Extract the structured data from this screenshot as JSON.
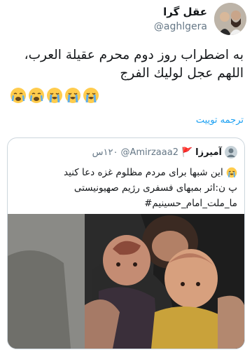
{
  "tweet": {
    "display_name": "عقل گرا",
    "handle": "@aghlgera",
    "text_line1": "به اضطراب روز دوم محرم عقيلة العرب،",
    "text_line2": "اللهم عجل لوليك الفرج",
    "emojis": [
      "crying-face",
      "crying-face",
      "loudly-crying-face",
      "loudly-crying-face",
      "loudly-crying-face"
    ],
    "translate_label": "ترجمه توییت"
  },
  "quoted": {
    "display_name": "آمیرزا",
    "flag": "🚩",
    "handle": "@Amirzaaa2",
    "time": "۱۲۰س",
    "line1": "این شبها برای مردم مظلوم غزه دعا کنید",
    "line2": "پ ن:اثر بمبهای فسفری رژیم صهیونیستی",
    "line3": "ما_ملت_امام_حسینیم#",
    "image_description_icon": "photo-women-children"
  },
  "colors": {
    "accent": "#1da1f2",
    "secondary_text": "#657786",
    "border": "#ccd6dd"
  }
}
